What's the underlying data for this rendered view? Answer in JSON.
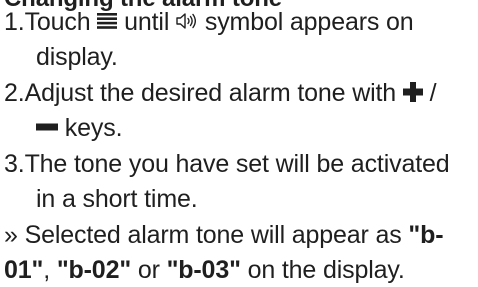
{
  "document": {
    "heading": "Changing the alarm tone",
    "steps": [
      {
        "number": "1.",
        "line1_before": "Touch",
        "line1_mid": "until",
        "line1_after": "symbol appears on",
        "line2": "display.",
        "menu_icon": "menu-lines-icon",
        "speaker_icon": "speaker-sound-icon"
      },
      {
        "number": "2.",
        "line1_before": "Adjust the desired alarm tone with",
        "line1_sep": "/",
        "line2": "keys.",
        "plus_icon": "plus-key-icon",
        "minus_icon": "minus-key-icon"
      },
      {
        "number": "3.",
        "line1": "The tone you have set will be activated",
        "line2": "in a short time."
      }
    ],
    "note": {
      "marker": "»",
      "line1_before": "Selected alarm tone will appear as",
      "code1_part1": "\"b-",
      "code1_part2": "01\"",
      "sep1": ",",
      "code2": "\"b-02\"",
      "or_text": "or",
      "code3": "\"b-03\"",
      "line2_after": "on the display."
    }
  }
}
